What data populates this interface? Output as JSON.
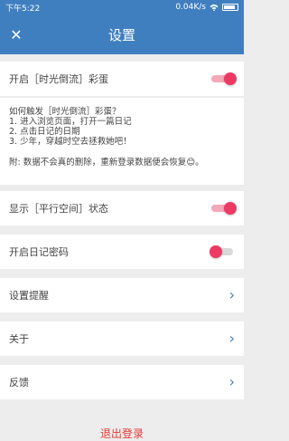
{
  "status_bar": {
    "time": "下午5:22",
    "network_speed": "0.04K/s",
    "wifi_icon": "wifi-icon",
    "battery_icon": "battery-icon"
  },
  "app_bar": {
    "close_icon": "close-icon",
    "title": "设置"
  },
  "settings": {
    "easter_egg": {
      "label": "开启［时光倒流］彩蛋",
      "enabled": true
    },
    "info": {
      "lines": [
        "如何触发［时光倒流］彩蛋？",
        "1. 进入浏览页面，打开一篇日记",
        "2. 点击日记的日期",
        "3. 少年，穿越时空去拯救她吧！"
      ],
      "note": "附: 数据不会真的删除，重新登录数据便会恢复😊。"
    },
    "parallel_space": {
      "label": "显示［平行空间］状态",
      "enabled": true
    },
    "diary_password": {
      "label": "开启日记密码",
      "enabled": false
    },
    "reminder": {
      "label": "设置提醒"
    },
    "about": {
      "label": "关于"
    },
    "feedback": {
      "label": "反馈"
    }
  },
  "logout_label": "退出登录",
  "colors": {
    "primary": "#3f7fc0",
    "toggle_accent": "#ec3a64",
    "logout": "#e53935"
  }
}
